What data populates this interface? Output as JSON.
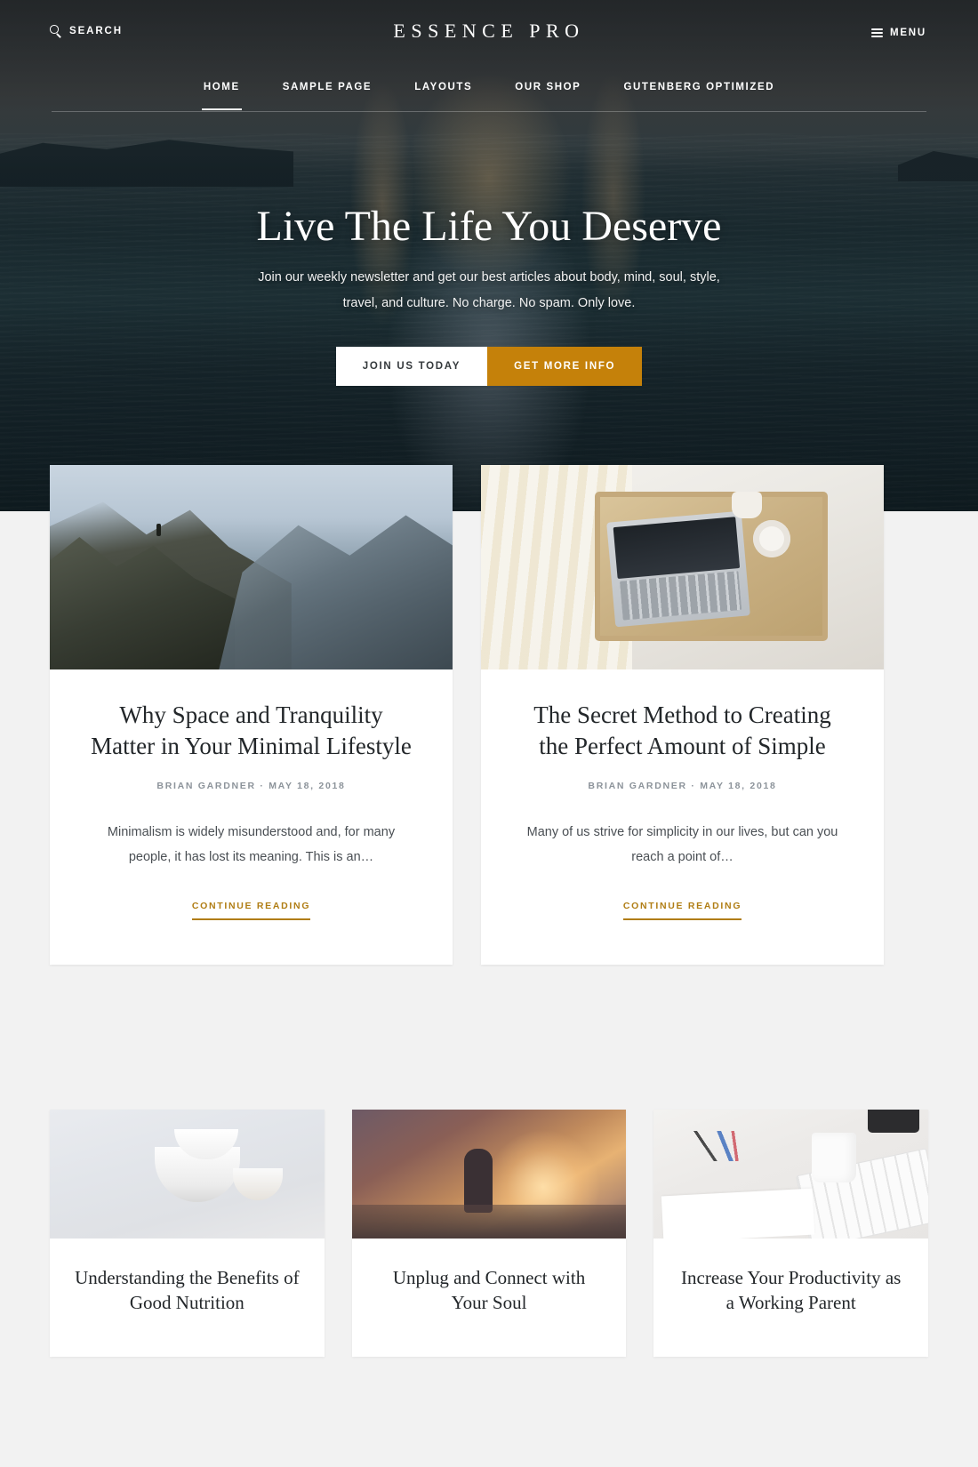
{
  "header": {
    "search_label": "SEARCH",
    "search_icon": "search-icon",
    "site_title": "ESSENCE PRO",
    "menu_label": "MENU",
    "menu_icon": "hamburger-icon"
  },
  "nav": {
    "items": [
      {
        "label": "HOME",
        "active": true
      },
      {
        "label": "SAMPLE PAGE",
        "active": false
      },
      {
        "label": "LAYOUTS",
        "active": false
      },
      {
        "label": "OUR SHOP",
        "active": false
      },
      {
        "label": "GUTENBERG OPTIMIZED",
        "active": false
      }
    ]
  },
  "hero": {
    "title": "Live The Life You Deserve",
    "subtitle": "Join our weekly newsletter and get our best articles about body, mind, soul, style, travel, and culture. No charge. No spam. Only love.",
    "primary_button": "JOIN US TODAY",
    "secondary_button": "GET MORE INFO"
  },
  "features": [
    {
      "image_name": "canyon-landscape-photo",
      "title": "Why Space and Tranquility Matter in Your Minimal Lifestyle",
      "byline": "BRIAN GARDNER · MAY 18, 2018",
      "excerpt": "Minimalism is widely misunderstood and, for many people, it has lost its meaning. This is an…",
      "more_label": "CONTINUE READING"
    },
    {
      "image_name": "laptop-breakfast-tray-photo",
      "title": "The Secret Method to Creating the Perfect Amount of Simple",
      "byline": "BRIAN GARDNER · MAY 18, 2018",
      "excerpt": "Many of us strive for simplicity in our lives, but can you reach a point of…",
      "more_label": "CONTINUE READING"
    }
  ],
  "small_posts": [
    {
      "image_name": "white-bowls-photo",
      "title": "Understanding the Benefits of Good Nutrition"
    },
    {
      "image_name": "sunset-hiker-photo",
      "title": "Unplug and Connect with Your Soul"
    },
    {
      "image_name": "desk-coffee-keyboard-photo",
      "title": "Increase Your Productivity as a Working Parent"
    }
  ],
  "colors": {
    "accent": "#c5810a",
    "link": "#b07d14",
    "page_background": "#f2f2f2",
    "card_background": "#ffffff",
    "heading_text": "#23272a",
    "muted_text": "#8c939a"
  }
}
